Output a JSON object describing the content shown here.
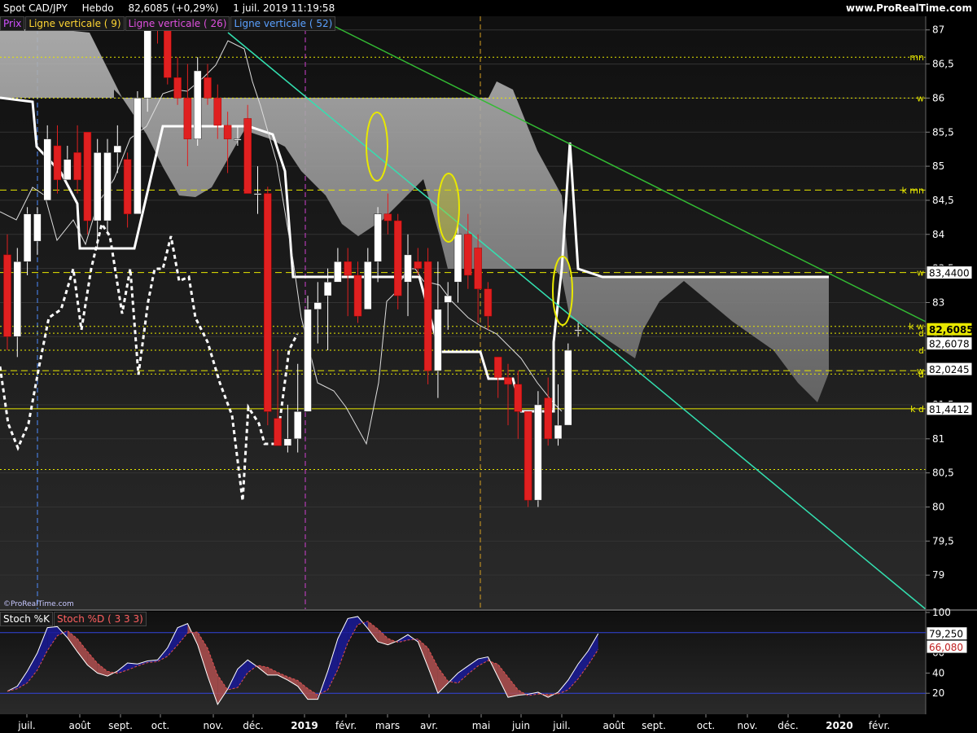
{
  "header": {
    "instrument": "Spot CAD/JPY",
    "timeframe": "Hebdo",
    "price": "82,6085 (+0,29%)",
    "datetime": "1 juil. 2019 11:19:58",
    "site": "www.ProRealTime.com"
  },
  "legend": {
    "prix": "Prix",
    "lv9": "Ligne verticale ( 9)",
    "lv26": "Ligne verticale ( 26)",
    "lv52": "Ligne verticale ( 52)"
  },
  "stoch_legend": {
    "k": "Stoch %K",
    "d": "Stoch %D ( 3 3 3)"
  },
  "copyright": "©ProRealTime.com",
  "colors": {
    "bull": "#ffffff",
    "bear": "#e02020",
    "cloud": "#9a9a9a",
    "trend_green": "#33cc33",
    "trend_cyan": "#33e0b0",
    "level": "#e8e800",
    "grid": "#333333",
    "stoch_k": "#ffffff",
    "stoch_d": "#e05050"
  },
  "chart_data": {
    "type": "candlestick",
    "price_axis": {
      "min": 78.5,
      "max": 87.2,
      "ticks": [
        "87",
        "86,5",
        "86",
        "85,5",
        "85",
        "84,5",
        "84",
        "83,5",
        "83",
        "82,5",
        "82",
        "81,5",
        "81",
        "80,5",
        "80",
        "79,5",
        "79"
      ]
    },
    "x_axis": {
      "labels": [
        "juil.",
        "août",
        "sept.",
        "oct.",
        "nov.",
        "déc.",
        "2019",
        "févr.",
        "mars",
        "avr.",
        "mai",
        "juin",
        "juil.",
        "août",
        "sept.",
        "oct.",
        "nov.",
        "déc.",
        "2020",
        "févr."
      ]
    },
    "candles": [
      [
        83.7,
        82.5,
        84.0,
        82.3
      ],
      [
        82.5,
        83.6,
        83.8,
        82.2
      ],
      [
        83.6,
        84.3,
        84.4,
        83.4
      ],
      [
        83.9,
        84.3,
        84.4,
        83.7
      ],
      [
        84.5,
        85.4,
        85.6,
        84.5
      ],
      [
        85.3,
        84.8,
        85.6,
        84.6
      ],
      [
        84.8,
        85.1,
        85.3,
        84.8
      ],
      [
        85.2,
        84.8,
        85.6,
        84.6
      ],
      [
        85.5,
        84.2,
        85.5,
        84.0
      ],
      [
        84.2,
        85.2,
        85.4,
        83.8
      ],
      [
        84.2,
        85.2,
        85.4,
        84.0
      ],
      [
        85.2,
        85.3,
        85.6,
        84.9
      ],
      [
        85.1,
        84.3,
        85.2,
        84.1
      ],
      [
        84.3,
        86.0,
        86.1,
        84.3
      ],
      [
        86.0,
        87.1,
        87.2,
        85.8
      ],
      [
        87.1,
        87.0,
        87.2,
        86.8
      ],
      [
        87.0,
        86.3,
        87.2,
        86.2
      ],
      [
        86.3,
        86.0,
        86.6,
        85.9
      ],
      [
        86.0,
        85.4,
        86.5,
        85.0
      ],
      [
        85.4,
        86.4,
        86.6,
        85.3
      ],
      [
        86.3,
        86.0,
        86.5,
        85.9
      ],
      [
        86.0,
        85.6,
        86.2,
        85.4
      ],
      [
        85.6,
        85.4,
        85.8,
        84.9
      ],
      [
        85.4,
        85.4,
        85.6,
        85.3
      ],
      [
        85.7,
        84.6,
        85.9,
        84.6
      ],
      [
        84.6,
        84.6,
        85.0,
        84.3
      ],
      [
        84.6,
        81.4,
        84.7,
        81.2
      ],
      [
        81.3,
        80.9,
        82.3,
        80.9
      ],
      [
        80.9,
        81.0,
        81.5,
        80.8
      ],
      [
        81.0,
        81.4,
        82.1,
        80.8
      ],
      [
        81.4,
        82.9,
        83.1,
        81.4
      ],
      [
        82.9,
        83.0,
        83.3,
        82.4
      ],
      [
        83.1,
        83.3,
        83.5,
        82.3
      ],
      [
        83.3,
        83.6,
        83.8,
        83.3
      ],
      [
        83.6,
        83.4,
        83.8,
        82.8
      ],
      [
        83.4,
        82.8,
        83.6,
        82.7
      ],
      [
        82.9,
        83.6,
        83.8,
        82.9
      ],
      [
        83.6,
        84.3,
        84.4,
        83.3
      ],
      [
        84.3,
        84.2,
        84.6,
        84.0
      ],
      [
        84.2,
        83.1,
        84.3,
        82.9
      ],
      [
        83.3,
        83.7,
        84.0,
        82.8
      ],
      [
        83.6,
        83.5,
        83.8,
        83.4
      ],
      [
        83.6,
        82.0,
        83.8,
        81.8
      ],
      [
        82.0,
        82.9,
        83.6,
        81.6
      ],
      [
        83.0,
        83.1,
        83.3,
        82.6
      ],
      [
        83.3,
        84.0,
        84.2,
        83.0
      ],
      [
        84.0,
        83.4,
        84.3,
        83.2
      ],
      [
        83.8,
        83.2,
        84.0,
        82.7
      ],
      [
        83.2,
        82.8,
        83.3,
        82.6
      ],
      [
        82.2,
        81.9,
        82.2,
        81.6
      ],
      [
        81.9,
        81.8,
        82.1,
        81.2
      ],
      [
        81.8,
        81.4,
        82.0,
        81.0
      ],
      [
        81.4,
        80.1,
        81.4,
        80.0
      ],
      [
        80.1,
        81.5,
        81.7,
        80.0
      ],
      [
        81.6,
        81.0,
        81.9,
        80.9
      ],
      [
        81.0,
        81.2,
        81.8,
        80.9
      ],
      [
        81.2,
        82.3,
        82.4,
        81.2
      ],
      [
        82.6,
        82.6,
        82.7,
        82.5
      ]
    ],
    "levels": [
      {
        "value": 86.6,
        "label": "mn",
        "style": "dotted"
      },
      {
        "value": 86.0,
        "label": "w",
        "style": "dotted"
      },
      {
        "value": 84.65,
        "label": "k mn",
        "style": "dashed"
      },
      {
        "value": 83.44,
        "label": "w",
        "style": "dashed"
      },
      {
        "value": 82.65,
        "label": "k w",
        "style": "dotted"
      },
      {
        "value": 82.55,
        "label": "d",
        "style": "dotted"
      },
      {
        "value": 82.3,
        "label": "d",
        "style": "dotted"
      },
      {
        "value": 82.0,
        "label": "w",
        "style": "dashed"
      },
      {
        "value": 81.95,
        "label": "d",
        "style": "dotted"
      },
      {
        "value": 81.4412,
        "label": "k d",
        "style": "solid"
      },
      {
        "value": 80.55,
        "label": "",
        "style": "dotted"
      }
    ],
    "price_badges": [
      {
        "value": 83.44,
        "text": "83,4400",
        "current": false
      },
      {
        "value": 82.6085,
        "text": "82,6085",
        "current": true
      },
      {
        "value": 82.4,
        "text": "82,6078",
        "current": false
      },
      {
        "value": 82.0245,
        "text": "82,0245",
        "current": false
      },
      {
        "value": 81.4412,
        "text": "81,4412",
        "current": false
      }
    ],
    "stochastic": {
      "ticks": [
        "20",
        "40",
        "60",
        "80",
        "100"
      ],
      "badges": [
        {
          "value": 79.25,
          "text": "79,250"
        },
        {
          "value": 66.08,
          "text": "66,080"
        }
      ],
      "k": [
        22,
        27,
        42,
        60,
        85,
        86,
        75,
        61,
        48,
        40,
        37,
        42,
        50,
        49,
        52,
        53,
        65,
        85,
        89,
        68,
        37,
        9,
        24,
        44,
        53,
        46,
        38,
        38,
        33,
        27,
        14,
        14,
        42,
        74,
        94,
        96,
        84,
        71,
        68,
        72,
        78,
        71,
        46,
        20,
        30,
        40,
        47,
        54,
        56,
        36,
        16,
        18,
        19,
        21,
        16,
        21,
        33,
        49,
        62,
        79
      ]
    }
  }
}
